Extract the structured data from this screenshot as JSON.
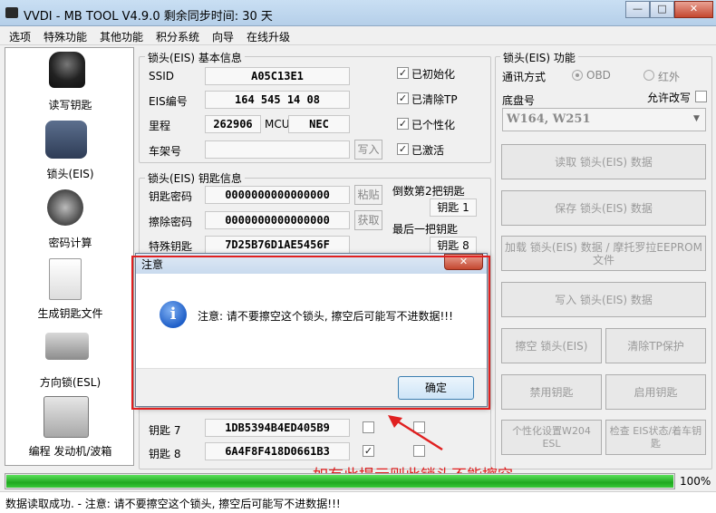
{
  "window": {
    "title": "VVDI - MB TOOL V4.9.0   剩余同步时间: 30 天"
  },
  "menu": [
    "选项",
    "特殊功能",
    "其他功能",
    "积分系统",
    "向导",
    "在线升级"
  ],
  "sidebar": {
    "items": [
      {
        "label": "读写钥匙"
      },
      {
        "label": "锁头(EIS)"
      },
      {
        "label": "密码计算"
      },
      {
        "label": "生成钥匙文件"
      },
      {
        "label": "方向锁(ESL)"
      },
      {
        "label": "编程 发动机/波箱"
      }
    ]
  },
  "eis_basic": {
    "legend": "锁头(EIS) 基本信息",
    "ssid_label": "SSID",
    "ssid": "A05C13E1",
    "eis_no_label": "EIS编号",
    "eis_no": "164 545 14 08",
    "mileage_label": "里程",
    "mileage": "262906",
    "mcu_label": "MCU",
    "mcu": "NEC",
    "vin_label": "车架号",
    "vin": "",
    "write_btn": "写入",
    "checks": [
      {
        "label": "已初始化",
        "checked": true
      },
      {
        "label": "已清除TP",
        "checked": true
      },
      {
        "label": "已个性化",
        "checked": true
      },
      {
        "label": "已激活",
        "checked": true
      }
    ]
  },
  "eis_key": {
    "legend": "锁头(EIS) 钥匙信息",
    "key_pwd_label": "钥匙密码",
    "key_pwd": "0000000000000000",
    "paste_btn": "粘贴",
    "erase_pwd_label": "擦除密码",
    "erase_pwd": "0000000000000000",
    "get_btn": "获取",
    "special_key_label": "特殊钥匙",
    "special_key": "7D25B76D1AE5456F",
    "second_last_label": "倒数第2把钥匙",
    "second_last_value": "钥匙 1",
    "last_label": "最后一把钥匙",
    "last_value": "钥匙 8",
    "rows": [
      {
        "label": "钥匙 7",
        "value": "1DB5394B4ED405B9",
        "checked": false
      },
      {
        "label": "钥匙 8",
        "value": "6A4F8F418D0661B3",
        "checked": true
      }
    ]
  },
  "eis_func": {
    "legend": "锁头(EIS) 功能",
    "comm_label": "通讯方式",
    "obd": "OBD",
    "ir": "红外",
    "chassis_label": "底盘号",
    "allow_rewrite": "允许改写",
    "chassis": "W164, W251",
    "buttons": {
      "read": "读取 锁头(EIS) 数据",
      "save": "保存 锁头(EIS) 数据",
      "load_line1": "加载 锁头(EIS) 数据 / 摩托罗拉EEPROM",
      "load_line2": "文件",
      "write": "写入 锁头(EIS) 数据",
      "erase": "擦空 锁头(EIS)",
      "clear_tp": "清除TP保护",
      "disable_key": "禁用钥匙",
      "enable_key": "启用钥匙",
      "personalize_line1": "个性化设置W204",
      "personalize_line2": "ESL",
      "check_line1": "检查 EIS状态/着车钥",
      "check_line2": "匙"
    }
  },
  "dialog": {
    "title": "注意",
    "message": "注意: 请不要擦空这个锁头, 擦空后可能写不进数据!!!",
    "ok": "确定"
  },
  "annotation": {
    "text": "如有此提示则此锁头不能擦空",
    "color": "#e02020"
  },
  "progress": {
    "value": 100,
    "label": "100%"
  },
  "status": "数据读取成功. - 注意: 请不要擦空这个锁头, 擦空后可能写不进数据!!!",
  "colors": {
    "accent": "#2b6fd1",
    "progress": "#1fa81f",
    "annotation": "#e02020"
  }
}
